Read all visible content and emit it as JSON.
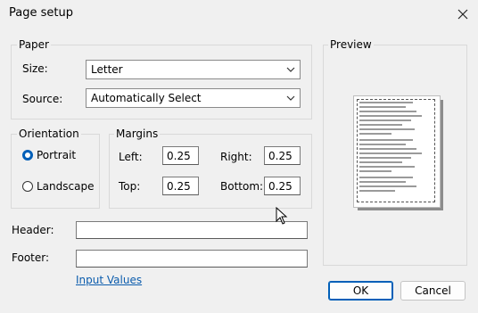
{
  "window": {
    "title": "Page setup"
  },
  "paper": {
    "group_label": "Paper",
    "size_label": "Size:",
    "size_value": "Letter",
    "source_label": "Source:",
    "source_value": "Automatically Select"
  },
  "orientation": {
    "group_label": "Orientation",
    "portrait_label": "Portrait",
    "landscape_label": "Landscape",
    "selected": "Portrait"
  },
  "margins": {
    "group_label": "Margins",
    "left_label": "Left:",
    "left_value": "0.25",
    "right_label": "Right:",
    "right_value": "0.25",
    "top_label": "Top:",
    "top_value": "0.25",
    "bottom_label": "Bottom:",
    "bottom_value": "0.25"
  },
  "header": {
    "label": "Header:",
    "value": ""
  },
  "footer": {
    "label": "Footer:",
    "value": ""
  },
  "input_values_link": "Input Values",
  "preview": {
    "group_label": "Preview"
  },
  "buttons": {
    "ok": "OK",
    "cancel": "Cancel"
  },
  "colors": {
    "accent": "#005fb8",
    "link": "#0b5cad"
  }
}
